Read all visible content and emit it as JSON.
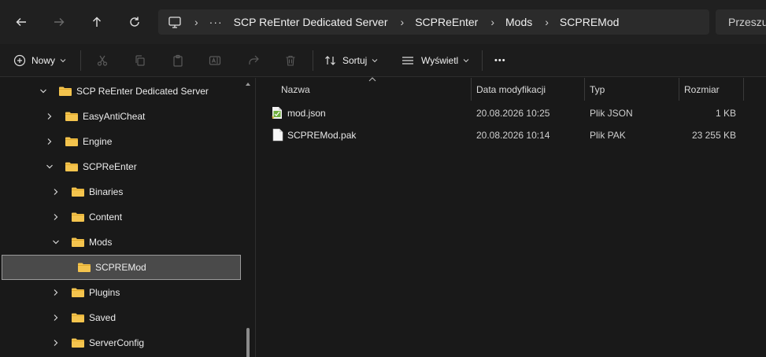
{
  "nav": {
    "back_icon": "arrow-left-icon",
    "forward_icon": "arrow-right-icon",
    "up_icon": "arrow-up-icon",
    "refresh_icon": "refresh-icon"
  },
  "address": {
    "ellipsis": "···",
    "crumbs": [
      "SCP ReEnter Dedicated Server",
      "SCPReEnter",
      "Mods",
      "SCPREMod"
    ]
  },
  "search": {
    "placeholder": "Przeszukaj"
  },
  "toolbar": {
    "new_label": "Nowy",
    "sort_label": "Sortuj",
    "view_label": "Wyświetl",
    "more_label": "•••"
  },
  "tree": [
    {
      "label": "SCP ReEnter Dedicated Server",
      "expanded": true
    },
    {
      "label": "EasyAntiCheat",
      "expanded": false
    },
    {
      "label": "Engine",
      "expanded": false
    },
    {
      "label": "SCPReEnter",
      "expanded": true
    },
    {
      "label": "Binaries",
      "expanded": false
    },
    {
      "label": "Content",
      "expanded": false
    },
    {
      "label": "Mods",
      "expanded": true
    },
    {
      "label": "SCPREMod",
      "selected": true
    },
    {
      "label": "Plugins",
      "expanded": false
    },
    {
      "label": "Saved",
      "expanded": false
    },
    {
      "label": "ServerConfig",
      "expanded": false
    }
  ],
  "columns": {
    "name": "Nazwa",
    "modified": "Data modyfikacji",
    "type": "Typ",
    "size": "Rozmiar"
  },
  "files": [
    {
      "name": "mod.json",
      "modified": "20.08.2026 10:25",
      "type": "Plik JSON",
      "size": "1 KB",
      "icon": "json-file-icon"
    },
    {
      "name": "SCPREMod.pak",
      "modified": "20.08.2026 10:14",
      "type": "Plik PAK",
      "size": "23 255 KB",
      "icon": "generic-file-icon"
    }
  ],
  "colors": {
    "folder": "#F4C44E",
    "selection": "#4A4A4A",
    "background": "#191919"
  }
}
